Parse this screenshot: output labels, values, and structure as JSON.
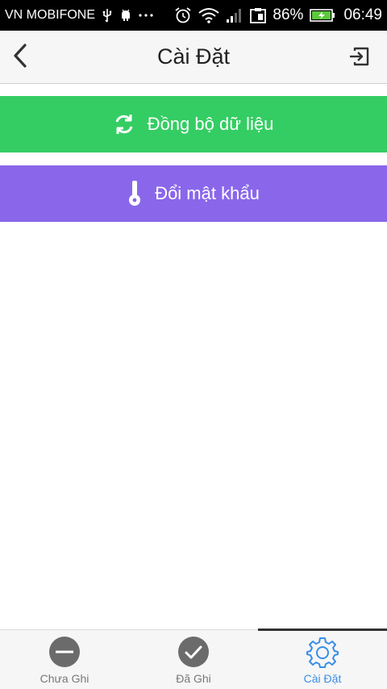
{
  "status_bar": {
    "carrier": "VN MOBIFONE",
    "battery_percent": "86%",
    "time": "06:49"
  },
  "header": {
    "title": "Cài Đặt"
  },
  "actions": {
    "sync_label": "Đồng bộ dữ liệu",
    "change_password_label": "Đổi mật khẩu"
  },
  "tabs": [
    {
      "label": "Chưa Ghi",
      "icon": "minus-circle-icon",
      "active": false
    },
    {
      "label": "Đã Ghi",
      "icon": "check-circle-icon",
      "active": false
    },
    {
      "label": "Cài Đặt",
      "icon": "gear-icon",
      "active": true
    }
  ],
  "colors": {
    "sync_button": "#34cd63",
    "password_button": "#8a67ea",
    "active_tab": "#3a8ee6",
    "inactive_tab_icon": "#6b6b6b"
  }
}
